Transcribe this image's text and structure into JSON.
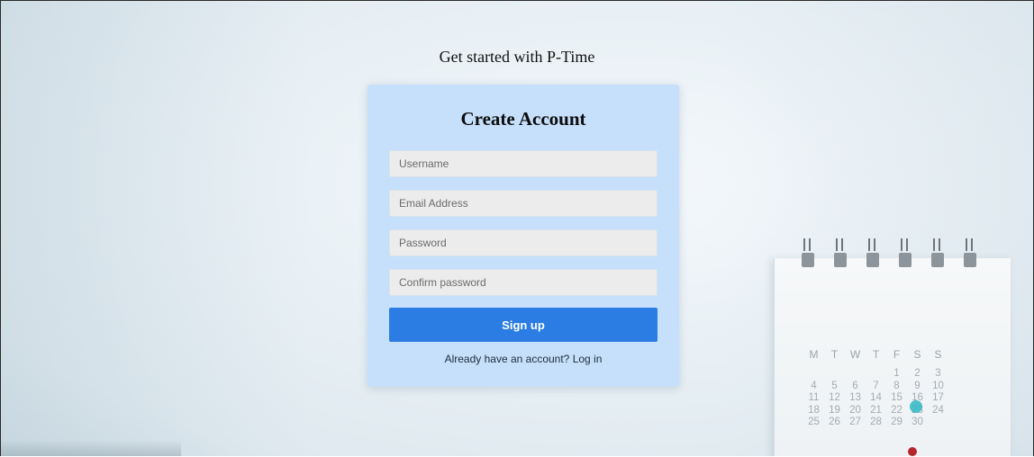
{
  "header": {
    "tagline": "Get started with P-Time"
  },
  "form": {
    "title": "Create Account",
    "username_placeholder": "Username",
    "email_placeholder": "Email Address",
    "password_placeholder": "Password",
    "confirm_placeholder": "Confirm password",
    "submit_label": "Sign up",
    "login_prompt": "Already have an account? Log in"
  },
  "calendar": {
    "weekdays": [
      "M",
      "T",
      "W",
      "T",
      "F",
      "S",
      "S"
    ],
    "rows": [
      [
        "",
        "",
        "",
        "",
        "1",
        "2",
        "3"
      ],
      [
        "4",
        "5",
        "6",
        "7",
        "8",
        "9",
        "10"
      ],
      [
        "11",
        "12",
        "13",
        "14",
        "15",
        "16",
        "17"
      ],
      [
        "18",
        "19",
        "20",
        "21",
        "22",
        "23",
        "24"
      ],
      [
        "25",
        "26",
        "27",
        "28",
        "29",
        "30",
        ""
      ]
    ]
  },
  "colors": {
    "card_bg": "#c6e0fb",
    "button_bg": "#2b7de3",
    "input_bg": "#ececec"
  }
}
